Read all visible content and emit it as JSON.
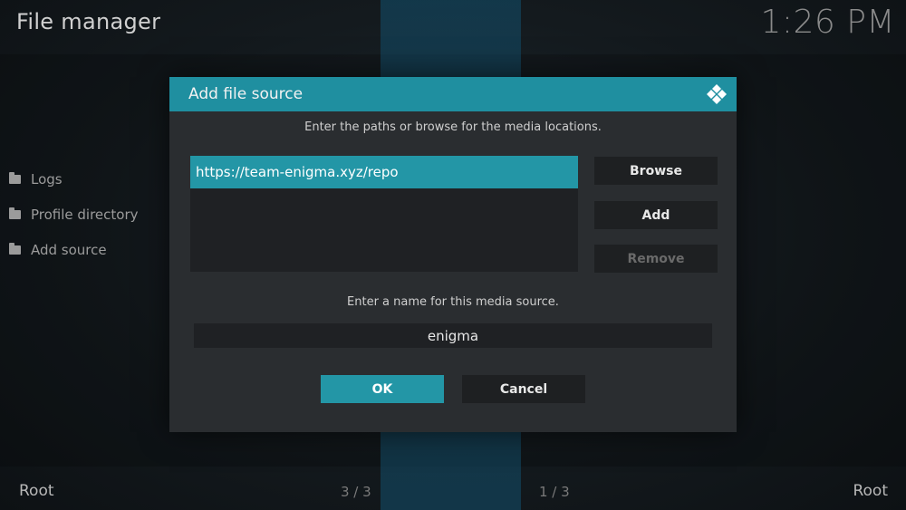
{
  "app": {
    "title": "File manager",
    "clock": "1:26 PM"
  },
  "sidebar": {
    "items": [
      {
        "label": "Logs",
        "icon": "folder-icon"
      },
      {
        "label": "Profile directory",
        "icon": "folder-icon"
      },
      {
        "label": "Add source",
        "icon": "folder-icon"
      }
    ]
  },
  "footer": {
    "left_label": "Root",
    "left_count": "3 / 3",
    "right_count": "1 / 3",
    "right_label": "Root"
  },
  "dialog": {
    "title": "Add file source",
    "logo_icon": "kodi-logo-icon",
    "paths_instruction": "Enter the paths or browse for the media locations.",
    "paths": [
      "https://team-enigma.xyz/repo"
    ],
    "browse_label": "Browse",
    "add_label": "Add",
    "remove_label": "Remove",
    "name_instruction": "Enter a name for this media source.",
    "name_value": "enigma",
    "ok_label": "OK",
    "cancel_label": "Cancel"
  },
  "colors": {
    "accent": "#2396a6",
    "header": "#1f8fa0",
    "dialog_bg": "#2a2d30"
  }
}
